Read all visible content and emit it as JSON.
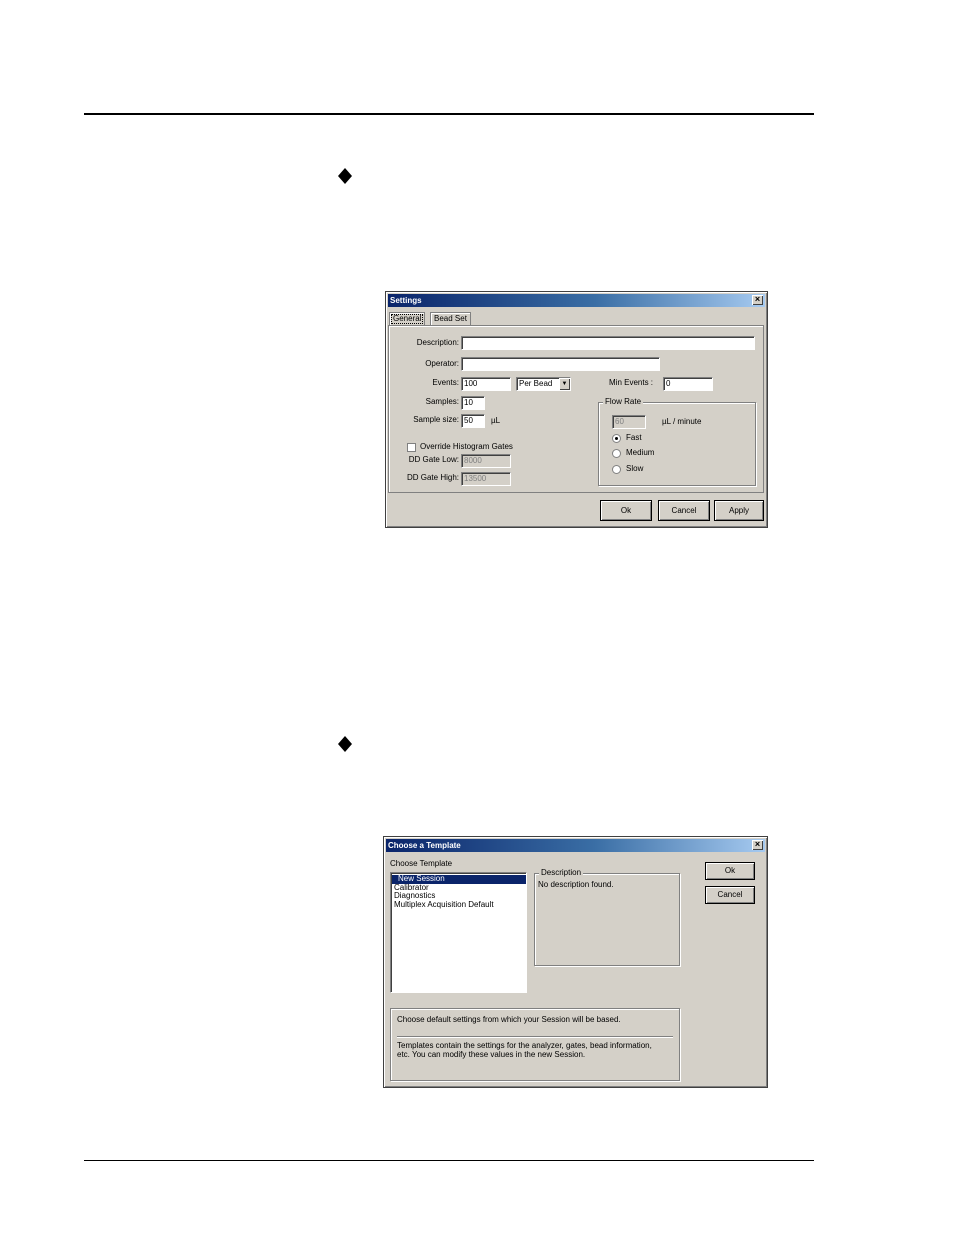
{
  "settings_dialog": {
    "title": "Settings",
    "tabs": [
      {
        "label": "General"
      },
      {
        "label": "Bead Set"
      }
    ],
    "description_label": "Description:",
    "description_value": "",
    "operator_label": "Operator:",
    "operator_value": "",
    "events_label": "Events:",
    "events_value": "100",
    "events_mode": "Per Bead",
    "min_events_label": "Min Events :",
    "min_events_value": "0",
    "samples_label": "Samples:",
    "samples_value": "10",
    "sample_size_label": "Sample size:",
    "sample_size_value": "50",
    "sample_size_unit": "µL",
    "flow_rate": {
      "legend": "Flow Rate",
      "value": "60",
      "unit": "µL / minute",
      "options": [
        {
          "label": "Fast",
          "selected": true
        },
        {
          "label": "Medium",
          "selected": false
        },
        {
          "label": "Slow",
          "selected": false
        }
      ]
    },
    "override_label": "Override Histogram Gates",
    "override_checked": false,
    "dd_gate_low_label": "DD Gate Low:",
    "dd_gate_low_value": "8000",
    "dd_gate_high_label": "DD Gate High:",
    "dd_gate_high_value": "13500",
    "buttons": {
      "ok": "Ok",
      "cancel": "Cancel",
      "apply": "Apply"
    }
  },
  "template_dialog": {
    "title": "Choose a Template",
    "choose_label": "Choose Template",
    "templates": [
      {
        "label": "New Session",
        "selected": true
      },
      {
        "label": "Calibrator",
        "selected": false
      },
      {
        "label": "Diagnostics",
        "selected": false
      },
      {
        "label": "Multiplex Acquisition Default",
        "selected": false
      }
    ],
    "description_legend": "Description",
    "description_text": "No description found.",
    "info_line1": "Choose default settings from which your Session will be based.",
    "info_line2": "Templates contain the settings for the analyzer, gates, bead information,",
    "info_line3": "etc.  You can modify these values in the new Session.",
    "buttons": {
      "ok": "Ok",
      "cancel": "Cancel"
    }
  }
}
